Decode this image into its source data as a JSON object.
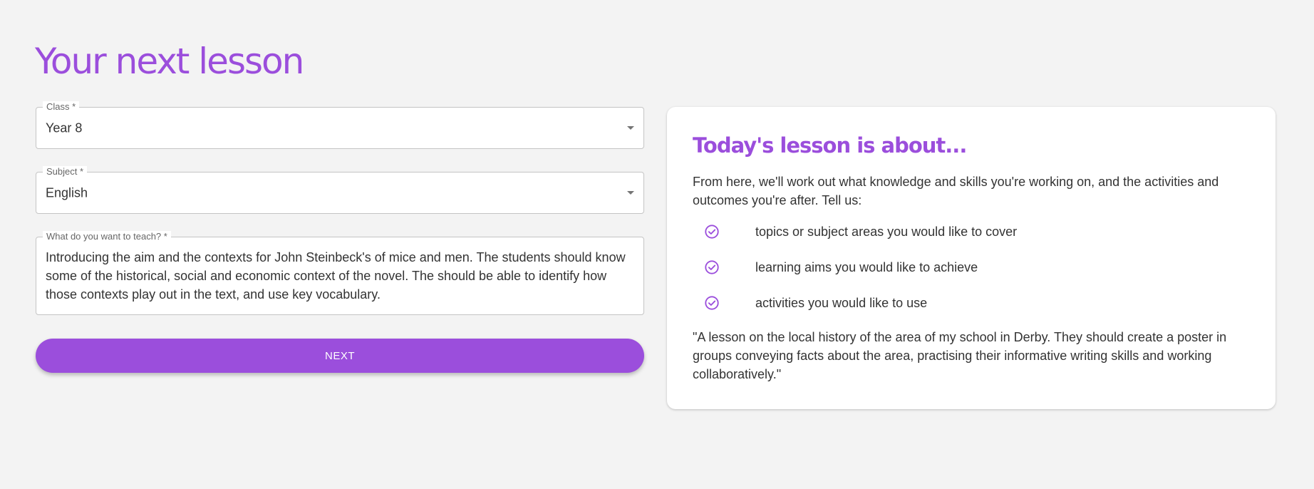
{
  "page_title": "Your next lesson",
  "form": {
    "class_field": {
      "label": "Class *",
      "value": "Year 8"
    },
    "subject_field": {
      "label": "Subject *",
      "value": "English"
    },
    "teach_field": {
      "label": "What do you want to teach? *",
      "value": "Introducing the aim and the contexts for John Steinbeck's of mice and men. The students should know some of the historical, social and economic context of the novel. The should be able to identify how those contexts play out in the text, and use key vocabulary."
    },
    "next_label": "NEXT"
  },
  "info_card": {
    "title": "Today's lesson is about...",
    "intro": "From here, we'll work out what knowledge and skills you're working on, and the activities and outcomes you're after. Tell us:",
    "items": [
      {
        "icon": "check-circle-icon",
        "text": "topics or subject areas you would like to cover"
      },
      {
        "icon": "check-circle-icon",
        "text": "learning aims you would like to achieve"
      },
      {
        "icon": "check-circle-icon",
        "text": "activities you would like to use"
      }
    ],
    "example": "\"A lesson on the local history of the area of my school in Derby. They should create a poster in groups conveying facts about the area, practising their informative writing skills and working collaboratively.\""
  },
  "colors": {
    "accent": "#9b4edc",
    "background": "#f3f3f3",
    "text": "#333333",
    "border": "#c4c4c4"
  }
}
